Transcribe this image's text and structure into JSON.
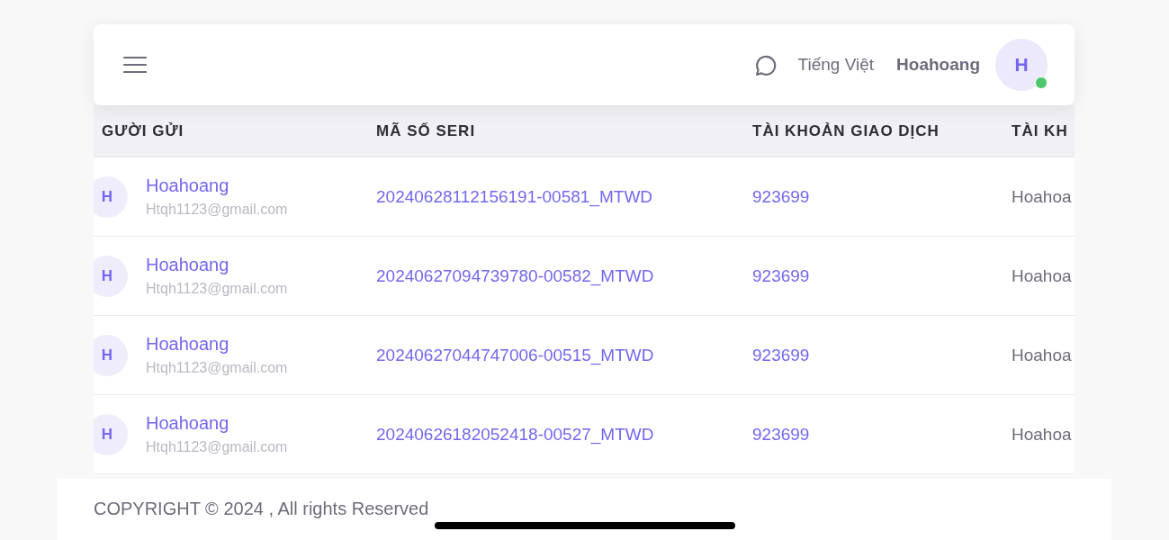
{
  "topbar": {
    "language": "Tiếng Việt",
    "user_name": "Hoahoang",
    "avatar_letter": "H",
    "online": true
  },
  "table": {
    "columns": [
      "GƯỜI GỬI",
      "MÃ SỐ SERI",
      "TÀI KHOẢN GIAO DỊCH",
      "TÀI KH"
    ],
    "rows": [
      {
        "avatar_letter": "H",
        "name": "Hoahoang",
        "email": "Htqh1123@gmail.com",
        "serial": "20240628112156191-00581_MTWD",
        "account": "923699",
        "column_4": "Hoahoa"
      },
      {
        "avatar_letter": "H",
        "name": "Hoahoang",
        "email": "Htqh1123@gmail.com",
        "serial": "20240627094739780-00582_MTWD",
        "account": "923699",
        "column_4": "Hoahoa"
      },
      {
        "avatar_letter": "H",
        "name": "Hoahoang",
        "email": "Htqh1123@gmail.com",
        "serial": "20240627044747006-00515_MTWD",
        "account": "923699",
        "column_4": "Hoahoa"
      },
      {
        "avatar_letter": "H",
        "name": "Hoahoang",
        "email": "Htqh1123@gmail.com",
        "serial": "20240626182052418-00527_MTWD",
        "account": "923699",
        "column_4": "Hoahoa"
      }
    ]
  },
  "footer": {
    "copyright": "COPYRIGHT © 2024 , All rights Reserved"
  }
}
